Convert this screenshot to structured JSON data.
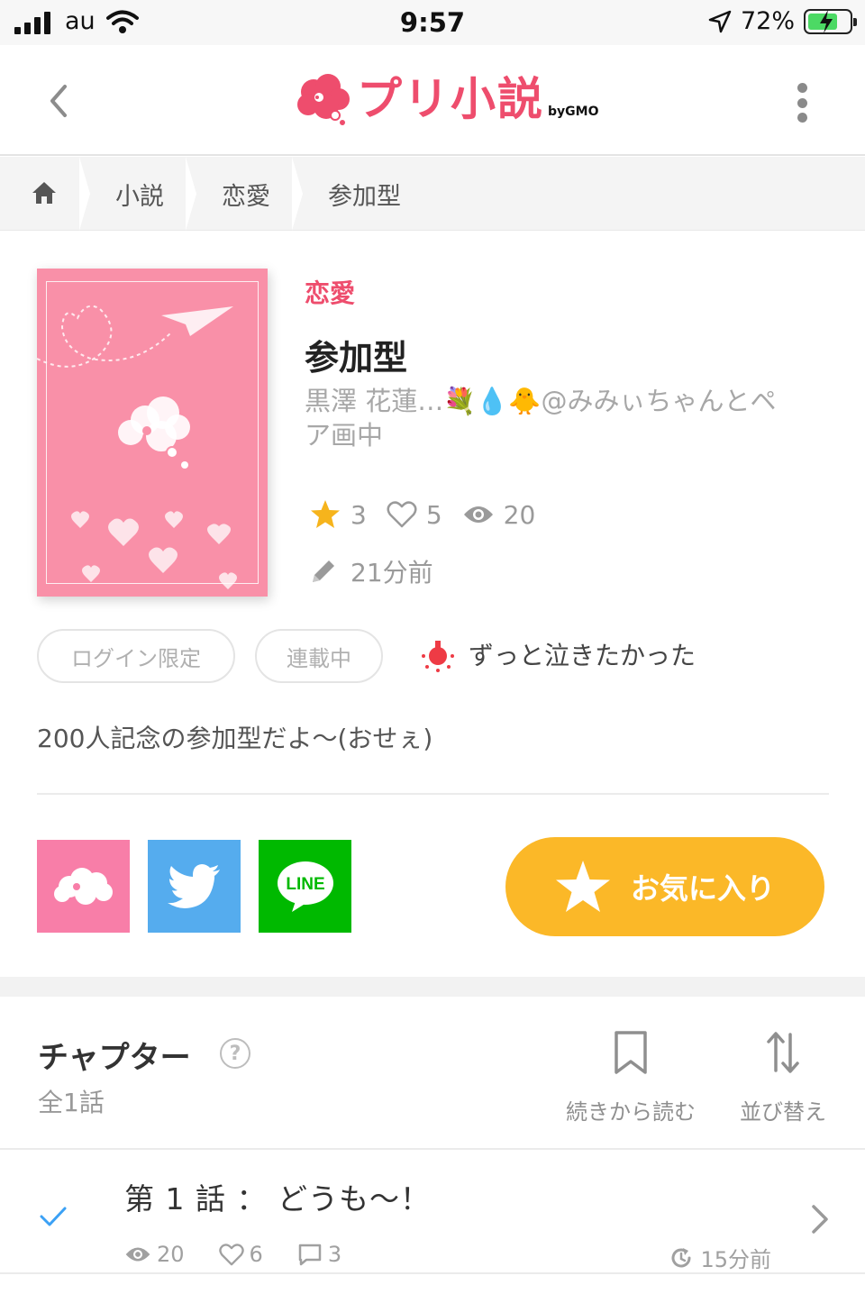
{
  "status_bar": {
    "carrier": "au",
    "time": "9:57",
    "battery_percent": "72%",
    "battery_level": 0.72
  },
  "header": {
    "logo_text": "プリ小説",
    "logo_by": "byGMO",
    "back_icon": "chevron-left-icon",
    "menu_icon": "kebab-menu-icon"
  },
  "breadcrumb": {
    "home_icon": "home-icon",
    "items": [
      "小説",
      "恋愛",
      "参加型"
    ]
  },
  "book": {
    "genre": "恋愛",
    "title": "参加型",
    "author_line1": "黒澤 花蓮…💐💧🐥@みみぃちゃんとペ",
    "author_line2": "ア画中",
    "stars": "3",
    "likes": "5",
    "views": "20",
    "updated": "21分前",
    "tags": [
      "ログイン限定",
      "連載中"
    ],
    "mood": "ずっと泣きたかった",
    "description": "200人記念の参加型だよ〜(おせぇ)"
  },
  "share": {
    "prism_icon": "prism-cloud-icon",
    "twitter_icon": "twitter-bird-icon",
    "line_label": "LINE"
  },
  "favorite": {
    "label": "お気に入り"
  },
  "chapters": {
    "title": "チャプター",
    "help": "?",
    "count": "全1話",
    "continue_label": "続きから読む",
    "sort_label": "並び替え",
    "episodes": [
      {
        "title": "第 1 話 ： どうも〜！",
        "views": "20",
        "likes": "6",
        "comments": "3",
        "time": "15分前"
      }
    ]
  },
  "colors": {
    "brand_pink": "#ee4d6d",
    "cover_pink": "#f990a8",
    "favorite_yellow": "#fbb828",
    "twitter_blue": "#55acee",
    "line_green": "#00b900",
    "prism_pink": "#f87ea8",
    "check_blue": "#3ba1f5"
  }
}
